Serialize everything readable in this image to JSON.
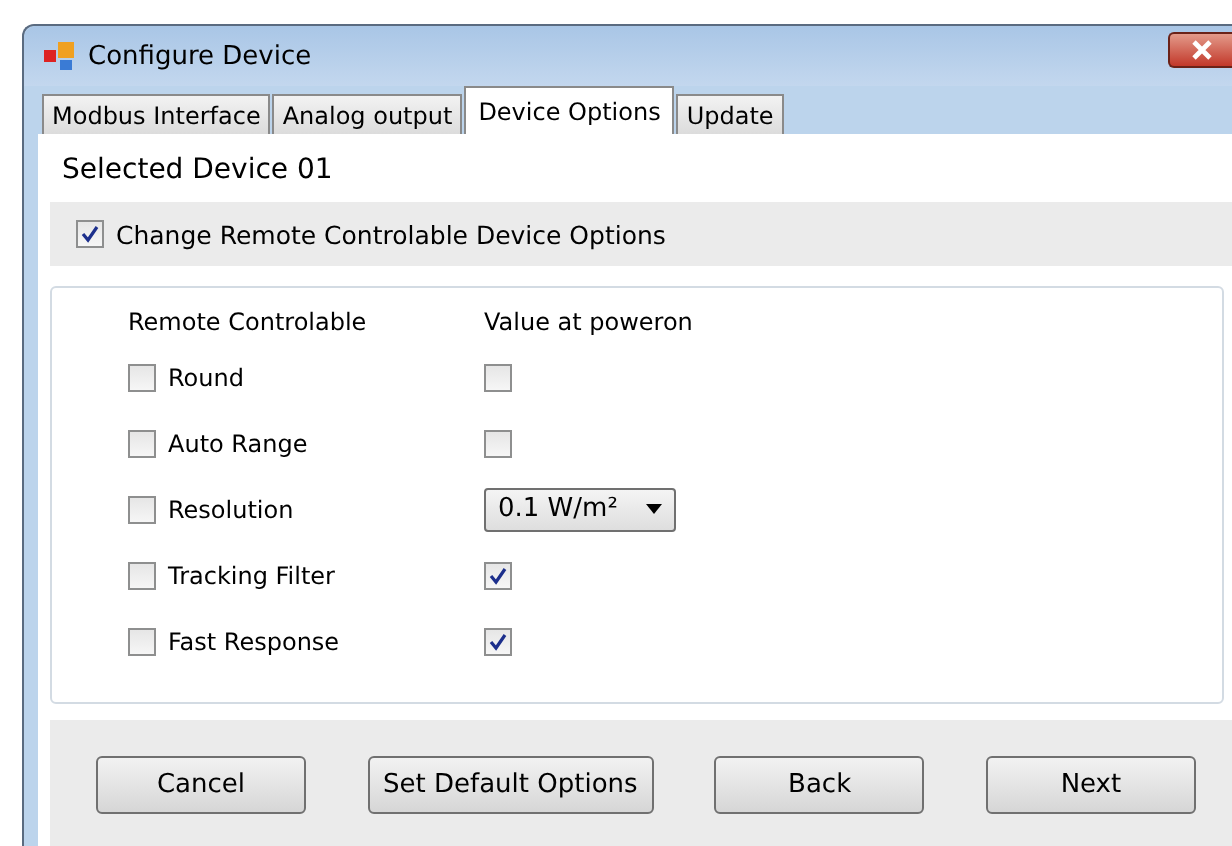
{
  "window": {
    "title": "Configure Device"
  },
  "tabs": [
    {
      "label": "Modbus Interface",
      "selected": false
    },
    {
      "label": "Analog output",
      "selected": false
    },
    {
      "label": "Device Options",
      "selected": true
    },
    {
      "label": "Update",
      "selected": false
    }
  ],
  "selected_device": "Selected Device 01",
  "change_options": {
    "label": "Change Remote Controlable Device Options",
    "checked": true
  },
  "columns": [
    "Remote Controlable",
    "Value at poweron"
  ],
  "options": [
    {
      "label": "Round",
      "checked": false,
      "kind": "checkbox",
      "value_checked": false
    },
    {
      "label": "Auto Range",
      "checked": false,
      "kind": "checkbox",
      "value_checked": false
    },
    {
      "label": "Resolution",
      "checked": false,
      "kind": "dropdown",
      "value": "0.1 W/m²"
    },
    {
      "label": "Tracking Filter",
      "checked": false,
      "kind": "checkbox",
      "value_checked": true
    },
    {
      "label": "Fast Response",
      "checked": false,
      "kind": "checkbox",
      "value_checked": true
    }
  ],
  "buttons": [
    "Cancel",
    "Set Default Options",
    "Back",
    "Next"
  ]
}
